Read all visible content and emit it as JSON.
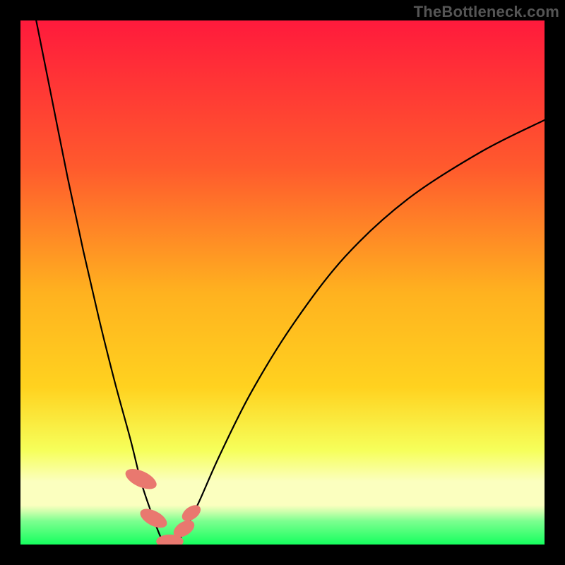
{
  "attribution": "TheBottleneck.com",
  "chart_data": {
    "type": "line",
    "title": "",
    "xlabel": "",
    "ylabel": "",
    "xlim": [
      0,
      100
    ],
    "ylim": [
      0,
      100
    ],
    "gradient_colors": {
      "top": "#ff1a3c",
      "mid_upper": "#ff8a2a",
      "mid": "#ffd21f",
      "mid_lower": "#f6ff5a",
      "band_pale": "#fbffbf",
      "bottom": "#15ff5e"
    },
    "series": [
      {
        "name": "left-arm",
        "x": [
          3,
          6,
          9,
          12,
          15,
          18,
          21,
          23,
          25,
          26.5,
          27.5
        ],
        "y": [
          100,
          85,
          70,
          56,
          43,
          31,
          20,
          12,
          6,
          2,
          0
        ]
      },
      {
        "name": "right-arm",
        "x": [
          29.5,
          31,
          34,
          38,
          44,
          52,
          62,
          74,
          88,
          100
        ],
        "y": [
          0,
          2,
          8,
          17,
          29,
          42,
          55,
          66,
          75,
          81
        ]
      }
    ],
    "markers": [
      {
        "name": "blob-left-upper",
        "cx": 23.0,
        "cy": 12.5,
        "rx": 1.5,
        "ry": 3.2,
        "angle": -65
      },
      {
        "name": "blob-left-lower",
        "cx": 25.4,
        "cy": 5.0,
        "rx": 1.4,
        "ry": 2.8,
        "angle": -62
      },
      {
        "name": "blob-bottom",
        "cx": 28.5,
        "cy": 0.6,
        "rx": 2.6,
        "ry": 1.3,
        "angle": 0
      },
      {
        "name": "blob-right-lower",
        "cx": 31.2,
        "cy": 3.0,
        "rx": 1.3,
        "ry": 2.2,
        "angle": 58
      },
      {
        "name": "blob-right-upper",
        "cx": 32.6,
        "cy": 6.0,
        "rx": 1.2,
        "ry": 2.0,
        "angle": 55
      }
    ],
    "marker_color": "#e9786f"
  }
}
